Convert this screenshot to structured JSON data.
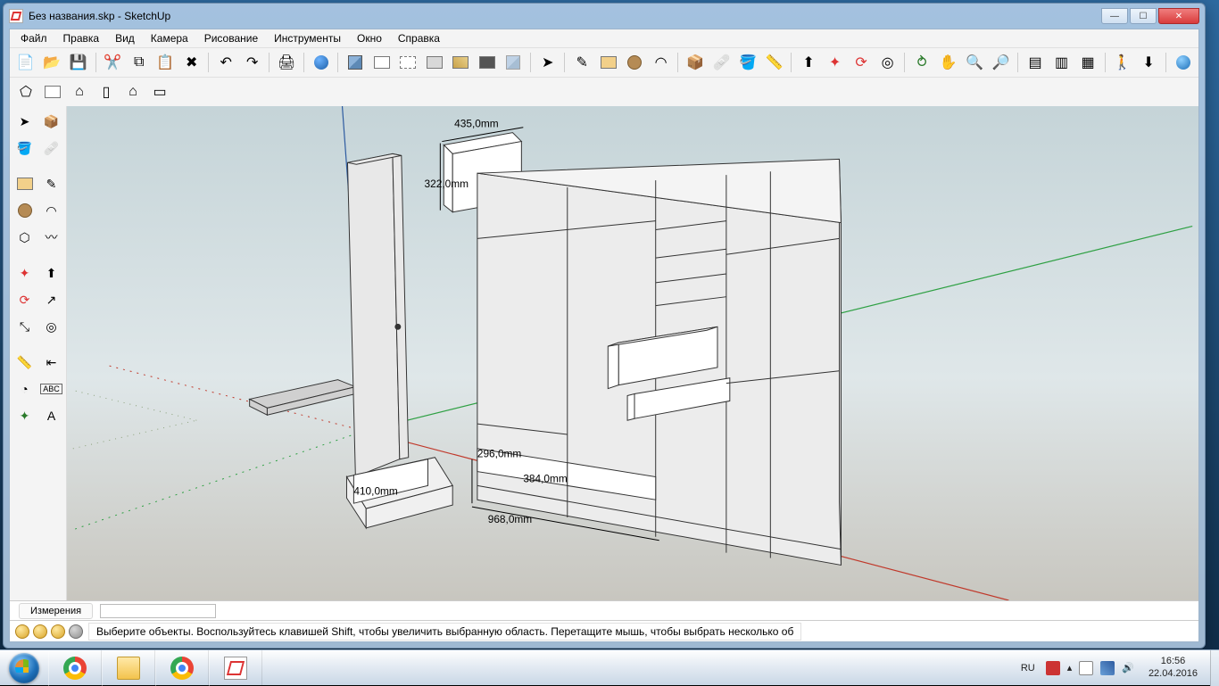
{
  "window": {
    "title": "Без названия.skp - SketchUp"
  },
  "menu": {
    "file": "Файл",
    "edit": "Правка",
    "view": "Вид",
    "camera": "Камера",
    "draw": "Рисование",
    "tools": "Инструменты",
    "window": "Окно",
    "help": "Справка"
  },
  "measurements": {
    "label": "Измерения",
    "value": ""
  },
  "status": {
    "hint": "Выберите объекты. Воспользуйтесь клавишей Shift, чтобы увеличить выбранную область. Перетащите мышь, чтобы выбрать несколько об"
  },
  "dimensions": {
    "d1": "435,0mm",
    "d2": "322,0mm",
    "d3": "296,0mm",
    "d4": "384,0mm",
    "d5": "968,0mm",
    "d6": "410,0mm"
  },
  "taskbar": {
    "lang": "RU",
    "time": "16:56",
    "date": "22.04.2016"
  }
}
